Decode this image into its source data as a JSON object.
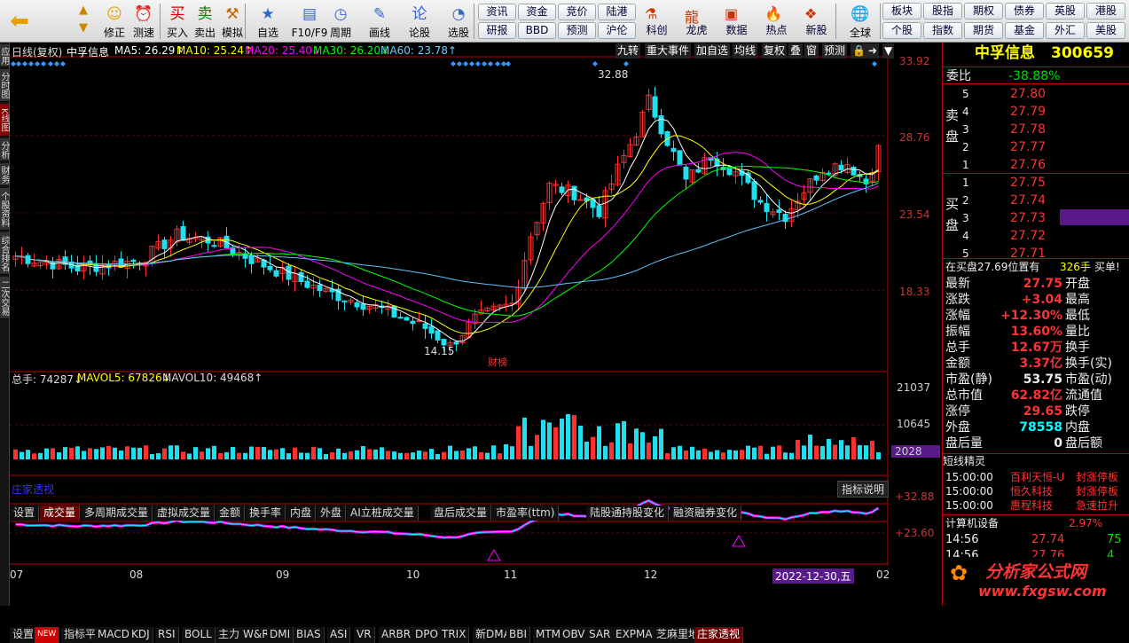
{
  "toolbar": {
    "main": [
      {
        "label": "修正",
        "icon": "smile-icon",
        "glyph": "☺"
      },
      {
        "label": "测速",
        "icon": "clock-icon",
        "glyph": "⏰"
      },
      {
        "label": "买入",
        "icon": "buy-icon",
        "glyph": "买"
      },
      {
        "label": "卖出",
        "icon": "sell-icon",
        "glyph": "卖"
      },
      {
        "label": "模拟",
        "icon": "hammer-icon",
        "glyph": "⚒"
      },
      {
        "label": "自选",
        "icon": "star-icon",
        "glyph": "★"
      },
      {
        "label": "F10/F9",
        "icon": "monitor-icon",
        "glyph": "▤"
      },
      {
        "label": "周期",
        "icon": "period-icon",
        "glyph": "◷"
      },
      {
        "label": "画线",
        "icon": "pencil-icon",
        "glyph": "✎"
      },
      {
        "label": "论股",
        "icon": "discuss-icon",
        "glyph": "论"
      },
      {
        "label": "选股",
        "icon": "gauge-icon",
        "glyph": "◔"
      }
    ],
    "text_row1": [
      "资讯",
      "资金",
      "竞价",
      "陆港",
      "科创",
      "龙虎",
      "数据",
      "热点",
      "新股"
    ],
    "text_row2": [
      "研报",
      "BBD",
      "预测",
      "沪伦"
    ],
    "global": "全球",
    "right_row1": [
      "板块",
      "股指",
      "期权",
      "债券",
      "英股",
      "港股"
    ],
    "right_row2": [
      "个股",
      "指数",
      "期货",
      "基金",
      "外汇",
      "美股"
    ]
  },
  "leftstrip": [
    "应用",
    "分时图",
    "K线图",
    "分析",
    "财务",
    "个股资料",
    "综合排名",
    "二次交易"
  ],
  "chart": {
    "indicators": {
      "title": "日线(复权)",
      "name": "中孚信息",
      "ma5": "MA5: 26.29↑",
      "ma10": "MA10: 25.24↑",
      "ma20": "MA20: 25.40↓",
      "ma30": "MA30: 26.20↓",
      "ma60": "MA60: 23.78↑"
    },
    "right_buttons": [
      "九转",
      "重大事件",
      "加自选",
      "均线",
      "复权",
      "叠",
      "窗",
      "预测"
    ],
    "price_axis": [
      "33.92",
      "28.76",
      "23.54",
      "18.33"
    ],
    "high_label": "32.88",
    "low_label": "14.15",
    "event_label": "财榜",
    "volume_info": {
      "total": "总手: 74287↓",
      "mavol5": "MAVOL5: 67826↓",
      "mavol10": "MAVOL10: 49468↑"
    },
    "volume_axis": [
      "21037",
      "10645",
      "2028"
    ],
    "tabs": [
      "设置",
      "成交量",
      "多周期成交量",
      "虚拟成交量",
      "金额",
      "换手率",
      "内盘",
      "外盘",
      "AI立桩成交量",
      "盘后成交量",
      "市盈率(ttm)",
      "陆股通持股变化",
      "融资融券变化"
    ],
    "indicator_title": "庄家透视",
    "indicator_help": "指标说明",
    "indicator_axis": [
      "+32.88",
      "+23.60"
    ],
    "months": [
      "07",
      "08",
      "09",
      "10",
      "11",
      "12",
      "02"
    ],
    "date_label": "2022-12-30,五",
    "bottom_tabs": [
      "设置",
      "NEW",
      "指标平台",
      "MACD",
      "KDJ",
      "RSI",
      "BOLL",
      "主力",
      "W&R",
      "DMI",
      "BIAS",
      "ASI",
      "VR",
      "ARBR",
      "DPO",
      "TRIX",
      "新DMA",
      "BBI",
      "MTM",
      "OBV",
      "SAR",
      "EXPMA",
      "芝麻里地量",
      "庄家透视"
    ],
    "colors": {
      "up": "#ff3030",
      "down": "#20e0f0",
      "ma5": "#ffffff",
      "ma10": "#ffff00",
      "ma20": "#ff00ff",
      "ma30": "#00ff00",
      "ma60": "#60c0ff"
    }
  },
  "quote": {
    "name": "中孚信息",
    "code": "300659",
    "weibi_label": "委比",
    "weibi": "-38.88%",
    "sell": [
      {
        "n": "5",
        "p": "27.80"
      },
      {
        "n": "4",
        "p": "27.79"
      },
      {
        "n": "3",
        "p": "27.78"
      },
      {
        "n": "2",
        "p": "27.77"
      },
      {
        "n": "1",
        "p": "27.76"
      }
    ],
    "buy": [
      {
        "n": "1",
        "p": "27.75"
      },
      {
        "n": "2",
        "p": "27.74"
      },
      {
        "n": "3",
        "p": "27.73"
      },
      {
        "n": "4",
        "p": "27.72"
      },
      {
        "n": "5",
        "p": "27.71"
      }
    ],
    "sell_label": "卖盘",
    "buy_label": "买盘",
    "notice": "在买盘27.69位置有",
    "notice_val": "326手",
    "notice_tail": "买单!",
    "stats": [
      [
        "最新",
        "27.75",
        "开盘"
      ],
      [
        "涨跌",
        "+3.04",
        "最高"
      ],
      [
        "涨幅",
        "+12.30%",
        "最低"
      ],
      [
        "振幅",
        "13.60%",
        "量比"
      ],
      [
        "总手",
        "12.67万",
        "换手"
      ],
      [
        "金额",
        "3.37亿",
        "换手(实)"
      ],
      [
        "市盈(静)",
        "53.75",
        "市盈(动)"
      ],
      [
        "总市值",
        "62.82亿",
        "流通值"
      ],
      [
        "涨停",
        "29.65",
        "跌停"
      ],
      [
        "外盘",
        "78558",
        "内盘"
      ],
      [
        "盘后量",
        "0",
        "盘后额"
      ]
    ],
    "elf_title": "短线精灵",
    "elf": [
      {
        "t": "15:00:00",
        "n": "百利天恒-U",
        "e": "封涨停板"
      },
      {
        "t": "15:00:00",
        "n": "恒久科技",
        "e": "封涨停板"
      },
      {
        "t": "15:00:00",
        "n": "惠程科技",
        "e": "急速拉升"
      }
    ],
    "sector": "计算机设备",
    "sector_pct": "2.97%",
    "ticks": [
      {
        "t": "14:56",
        "p": "27.74",
        "v": "75"
      },
      {
        "t": "14:56",
        "p": "27.76",
        "v": "4"
      }
    ],
    "watermark": "分析家公式网",
    "url": "www.fxgsw.com"
  }
}
